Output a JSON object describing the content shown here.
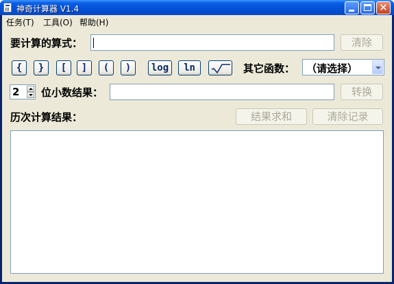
{
  "window": {
    "title": "神奇计算器 V1.4"
  },
  "menu": {
    "items": [
      {
        "label": "任务(T)"
      },
      {
        "label": "工具(O)"
      },
      {
        "label": "帮助(H)"
      }
    ]
  },
  "expression": {
    "label": "要计算的算式：",
    "value": "",
    "clear_label": "清除"
  },
  "keys": [
    {
      "label": "{"
    },
    {
      "label": "}"
    },
    {
      "label": "["
    },
    {
      "label": "]"
    },
    {
      "label": "("
    },
    {
      "label": ")"
    },
    {
      "label": "log"
    },
    {
      "label": "ln"
    }
  ],
  "other_functions": {
    "label": "其它函数：",
    "selected": "（请选择）"
  },
  "precision": {
    "value": "2",
    "label": "位小数结果：",
    "result_value": "",
    "convert_label": "转换"
  },
  "history": {
    "label": "历次计算结果：",
    "sum_label": "结果求和",
    "clear_label": "清除记录"
  },
  "colors": {
    "title_bar": "#0a5fe4",
    "face": "#ece9d8",
    "key_text": "#0a2a6a",
    "disabled_text": "#aca899"
  }
}
